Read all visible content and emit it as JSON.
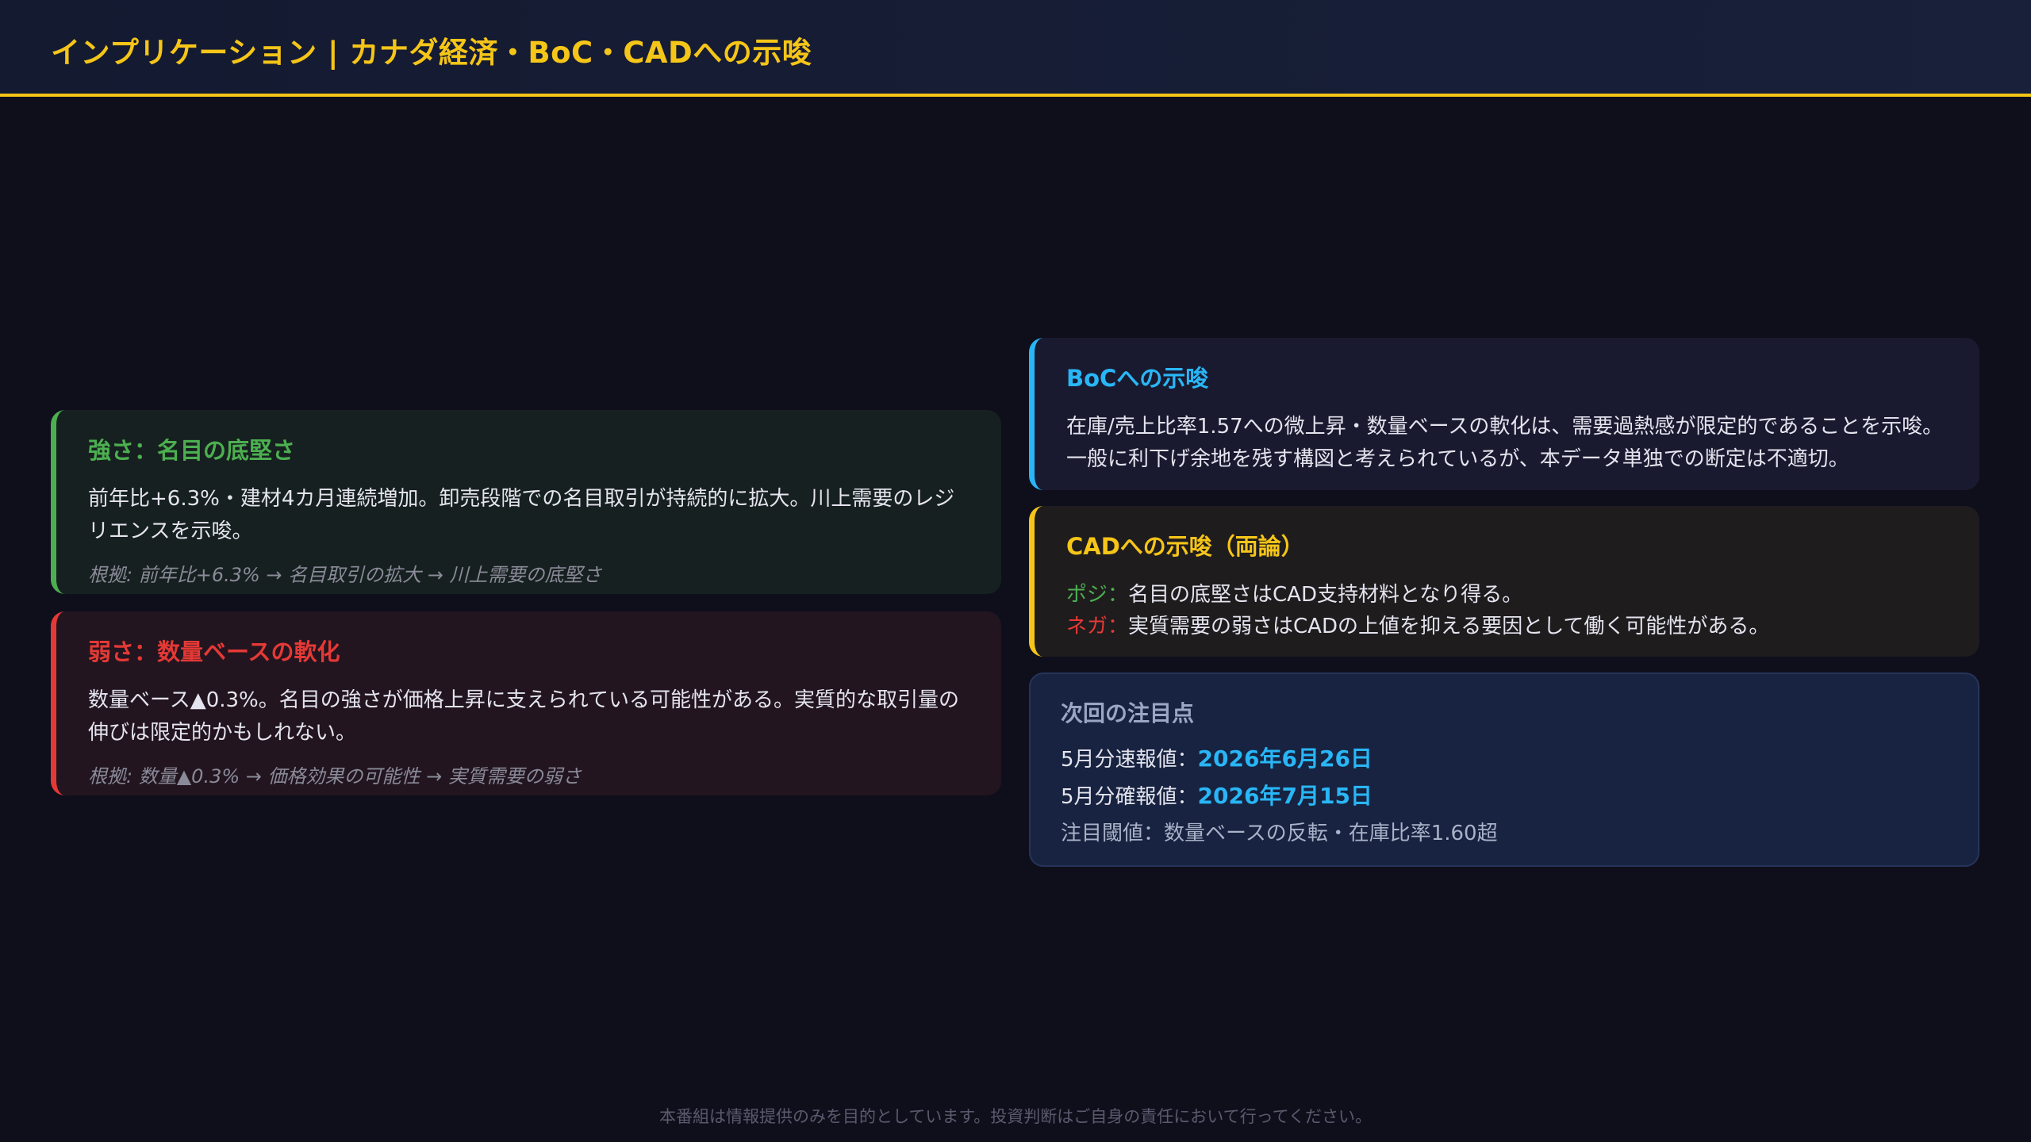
{
  "header": {
    "title": "インプリケーション | カナダ経済・BoC・CADへの示唆"
  },
  "strength": {
    "title": "強さ：名目の底堅さ",
    "body": "前年比+6.3%・建材4カ月連続増加。卸売段階での名目取引が持続的に拡大。川上需要のレジリエンスを示唆。",
    "evidence": "根拠: 前年比+6.3% → 名目取引の拡大 → 川上需要の底堅さ"
  },
  "weakness": {
    "title": "弱さ：数量ベースの軟化",
    "body": "数量ベース▲0.3%。名目の強さが価格上昇に支えられている可能性がある。実質的な取引量の伸びは限定的かもしれない。",
    "evidence": "根拠: 数量▲0.3% → 価格効果の可能性 → 実質需要の弱さ"
  },
  "boc": {
    "title": "BoCへの示唆",
    "body": "在庫/売上比率1.57への微上昇・数量ベースの軟化は、需要過熱感が限定的であることを示唆。一般に利下げ余地を残す構図と考えられているが、本データ単独での断定は不適切。"
  },
  "cad": {
    "title": "CADへの示唆（両論）",
    "pos_label": "ポジ：",
    "pos_text": "名目の底堅さはCAD支持材料となり得る。",
    "neg_label": "ネガ：",
    "neg_text": "実質需要の弱さはCADの上値を抑える要因として働く可能性がある。"
  },
  "next": {
    "title": "次回の注目点",
    "prelim_label": "5月分速報値：",
    "prelim_date": "2026年6月26日",
    "final_label": "5月分確報値：",
    "final_date": "2026年7月15日",
    "threshold": "注目閾値：数量ベースの反転・在庫比率1.60超"
  },
  "footer": {
    "disclaimer": "本番組は情報提供のみを目的としています。投資判断はご自身の責任において行ってください。"
  },
  "colors": {
    "accent_yellow": "#f5c518",
    "positive_green": "#4caf50",
    "negative_red": "#e53935",
    "info_blue": "#29b6f6",
    "background": "#0f0f1c"
  }
}
